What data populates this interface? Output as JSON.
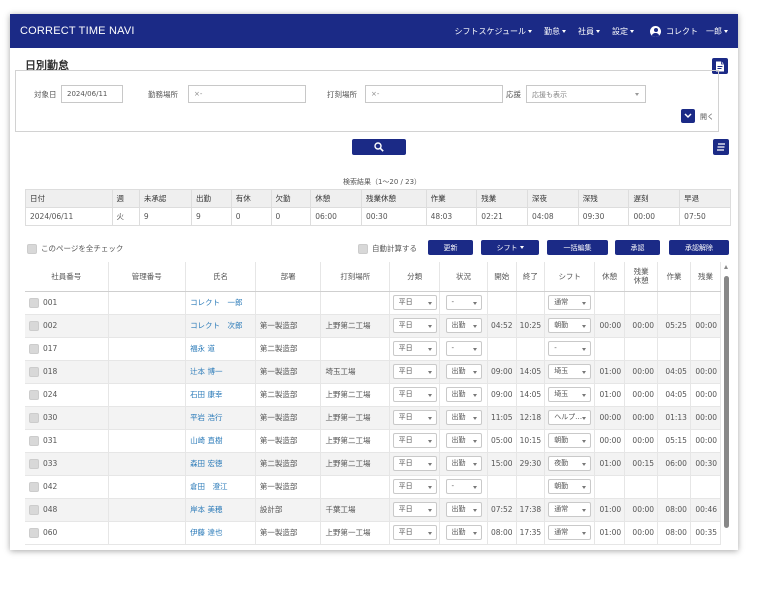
{
  "app": {
    "brand": "CORRECT TIME NAVI"
  },
  "nav": {
    "items": [
      "シフトスケジュール",
      "勤怠",
      "社員",
      "設定"
    ],
    "user": "コレクト　一郎"
  },
  "page": {
    "title": "日別勤怠"
  },
  "filters": {
    "date_label": "対象日",
    "date_value": "2024/06/11",
    "workplace_label": "勤務場所",
    "workplace_value": "×-",
    "stamp_place_label": "打刻場所",
    "stamp_place_value": "×-",
    "support_label": "応援",
    "support_value": "応援も表示",
    "toggle_label": "開く"
  },
  "result_text": "検索結果（1〜20 / 23）",
  "summary": {
    "headers": [
      "日付",
      "週",
      "未承認",
      "出勤",
      "有休",
      "欠勤",
      "休憩",
      "残業休憩",
      "作業",
      "残業",
      "深夜",
      "深残",
      "遅刻",
      "早退"
    ],
    "row": [
      "2024/06/11",
      "火",
      "9",
      "9",
      "0",
      "0",
      "06:00",
      "00:30",
      "48:03",
      "02:21",
      "04:08",
      "09:30",
      "00:00",
      "07:50"
    ]
  },
  "actions": {
    "check_all": "このページを全チェック",
    "auto_calc": "自動計算する",
    "update": "更新",
    "shift": "シフト",
    "bulk_edit": "一括編集",
    "approve": "承認",
    "unapprove": "承認解除"
  },
  "grid": {
    "headers": [
      "社員番号",
      "管理番号",
      "氏名",
      "部署",
      "打刻場所",
      "分類",
      "状況",
      "開始",
      "終了",
      "シフト",
      "休憩",
      "残業\n休憩",
      "作業",
      "残業"
    ],
    "rows": [
      {
        "id": "001",
        "mgmt": "",
        "name": "コレクト　一郎",
        "dept": "",
        "place": "",
        "cat": "平日",
        "status": "-",
        "start": "",
        "end": "",
        "shift": "通常",
        "brk": "",
        "obrk": "",
        "work": "",
        "ot": ""
      },
      {
        "id": "002",
        "mgmt": "",
        "name": "コレクト　次郎",
        "dept": "第一製造部",
        "place": "上野第二工場",
        "cat": "平日",
        "status": "出勤",
        "start": "04:52",
        "end": "10:25",
        "shift": "朝勤",
        "brk": "00:00",
        "obrk": "00:00",
        "work": "05:25",
        "ot": "00:00"
      },
      {
        "id": "017",
        "mgmt": "",
        "name": "福永 道",
        "dept": "第二製造部",
        "place": "",
        "cat": "平日",
        "status": "-",
        "start": "",
        "end": "",
        "shift": "-",
        "brk": "",
        "obrk": "",
        "work": "",
        "ot": ""
      },
      {
        "id": "018",
        "mgmt": "",
        "name": "辻本 博一",
        "dept": "第一製造部",
        "place": "埼玉工場",
        "cat": "平日",
        "status": "出勤",
        "start": "09:00",
        "end": "14:05",
        "shift": "埼玉",
        "brk": "01:00",
        "obrk": "00:00",
        "work": "04:05",
        "ot": "00:00"
      },
      {
        "id": "024",
        "mgmt": "",
        "name": "石田 康幸",
        "dept": "第二製造部",
        "place": "上野第二工場",
        "cat": "平日",
        "status": "出勤",
        "start": "09:00",
        "end": "14:05",
        "shift": "埼玉",
        "brk": "01:00",
        "obrk": "00:00",
        "work": "04:05",
        "ot": "00:00"
      },
      {
        "id": "030",
        "mgmt": "",
        "name": "平岩 浩行",
        "dept": "第一製造部",
        "place": "上野第一工場",
        "cat": "平日",
        "status": "出勤",
        "start": "11:05",
        "end": "12:18",
        "shift": "ヘルプ…",
        "brk": "00:00",
        "obrk": "00:00",
        "work": "01:13",
        "ot": "00:00"
      },
      {
        "id": "031",
        "mgmt": "",
        "name": "山崎 直樹",
        "dept": "第一製造部",
        "place": "上野第二工場",
        "cat": "平日",
        "status": "出勤",
        "start": "05:00",
        "end": "10:15",
        "shift": "朝勤",
        "brk": "00:00",
        "obrk": "00:00",
        "work": "05:15",
        "ot": "00:00"
      },
      {
        "id": "033",
        "mgmt": "",
        "name": "森田 宏徳",
        "dept": "第二製造部",
        "place": "上野第二工場",
        "cat": "平日",
        "status": "出勤",
        "start": "15:00",
        "end": "29:30",
        "shift": "夜勤",
        "brk": "01:00",
        "obrk": "00:15",
        "work": "06:00",
        "ot": "00:30"
      },
      {
        "id": "042",
        "mgmt": "",
        "name": "倉田　澄江",
        "dept": "第一製造部",
        "place": "",
        "cat": "平日",
        "status": "-",
        "start": "",
        "end": "",
        "shift": "朝勤",
        "brk": "",
        "obrk": "",
        "work": "",
        "ot": ""
      },
      {
        "id": "048",
        "mgmt": "",
        "name": "岸本 美穂",
        "dept": "設計部",
        "place": "千葉工場",
        "cat": "平日",
        "status": "出勤",
        "start": "07:52",
        "end": "17:38",
        "shift": "通常",
        "brk": "01:00",
        "obrk": "00:00",
        "work": "08:00",
        "ot": "00:46"
      },
      {
        "id": "060",
        "mgmt": "",
        "name": "伊藤 達也",
        "dept": "第一製造部",
        "place": "上野第一工場",
        "cat": "平日",
        "status": "出勤",
        "start": "08:00",
        "end": "17:35",
        "shift": "通常",
        "brk": "01:00",
        "obrk": "00:00",
        "work": "08:00",
        "ot": "00:35"
      }
    ]
  },
  "icons": {
    "pdf": "pdf-icon",
    "search": "search-icon",
    "list": "list-icon",
    "toggle": "chevron-down-icon",
    "user": "user-circle-icon"
  },
  "colors": {
    "header": "#1b2a86",
    "link": "#2a7ab8"
  }
}
